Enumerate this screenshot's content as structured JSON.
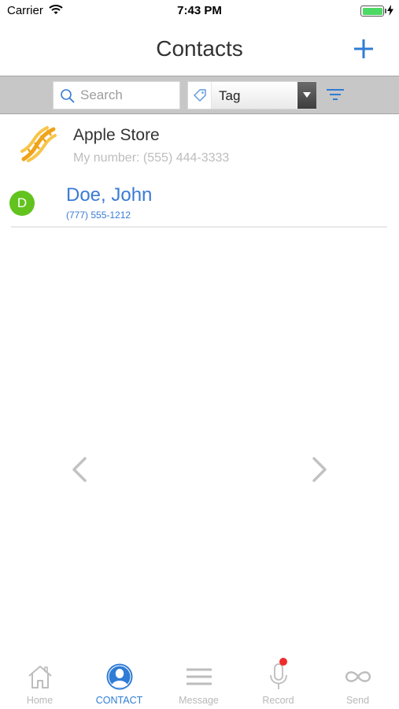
{
  "status_bar": {
    "carrier": "Carrier",
    "time": "7:43 PM",
    "battery_level": 1.0
  },
  "nav": {
    "title": "Contacts",
    "add_icon": "plus-icon"
  },
  "toolbar": {
    "search_placeholder": "Search",
    "search_value": "",
    "tag_selected": "Tag",
    "filter_icon": "filter-lines-icon"
  },
  "contacts": [
    {
      "name": "Apple Store",
      "subtitle": "My number: (555) 444-3333",
      "icon": "dna-icon"
    },
    {
      "name": "Doe, John",
      "initial": "D",
      "phone": "(777) 555-1212",
      "avatar_color": "#62c31e"
    }
  ],
  "pager": {
    "prev_icon": "chevron-left-icon",
    "next_icon": "chevron-right-icon"
  },
  "tabs": [
    {
      "label": "Home",
      "icon": "home-icon",
      "active": false
    },
    {
      "label": "CONTACT",
      "icon": "contact-icon",
      "active": true
    },
    {
      "label": "Message",
      "icon": "message-lines-icon",
      "active": false
    },
    {
      "label": "Record",
      "icon": "microphone-icon",
      "active": false,
      "badge": true
    },
    {
      "label": "Send",
      "icon": "infinity-icon",
      "active": false
    }
  ],
  "colors": {
    "accent": "#2f7cd6",
    "link": "#3a7bd5",
    "inactive_tab": "#b8b8b8",
    "toolbar_bg": "#c7c7c7",
    "badge": "#f02a2a"
  }
}
